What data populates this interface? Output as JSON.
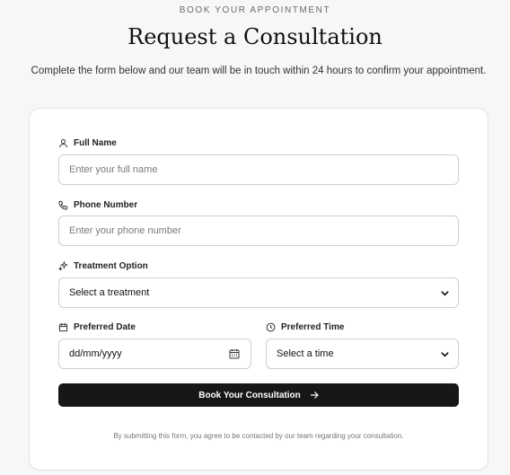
{
  "header": {
    "eyebrow": "BOOK YOUR APPOINTMENT",
    "title": "Request a Consultation",
    "subtitle": "Complete the form below and our team will be in touch within 24 hours to confirm your appointment."
  },
  "form": {
    "full_name": {
      "label": "Full Name",
      "placeholder": "Enter your full name",
      "icon": "user-icon"
    },
    "phone": {
      "label": "Phone Number",
      "placeholder": "Enter your phone number",
      "icon": "phone-icon"
    },
    "treatment": {
      "label": "Treatment Option",
      "selected": "Select a treatment",
      "icon": "sparkles-icon"
    },
    "date": {
      "label": "Preferred Date",
      "value": "dd/mm/yyyy",
      "icon": "calendar-icon"
    },
    "time": {
      "label": "Preferred Time",
      "selected": "Select a time",
      "icon": "clock-icon"
    },
    "submit_label": "Book Your Consultation",
    "disclaimer": "By submitting this form, you agree to be contacted by our team regarding your consultation."
  },
  "colors": {
    "button_bg": "#171717",
    "page_bg": "#f7f7f7",
    "card_bg": "#ffffff"
  }
}
